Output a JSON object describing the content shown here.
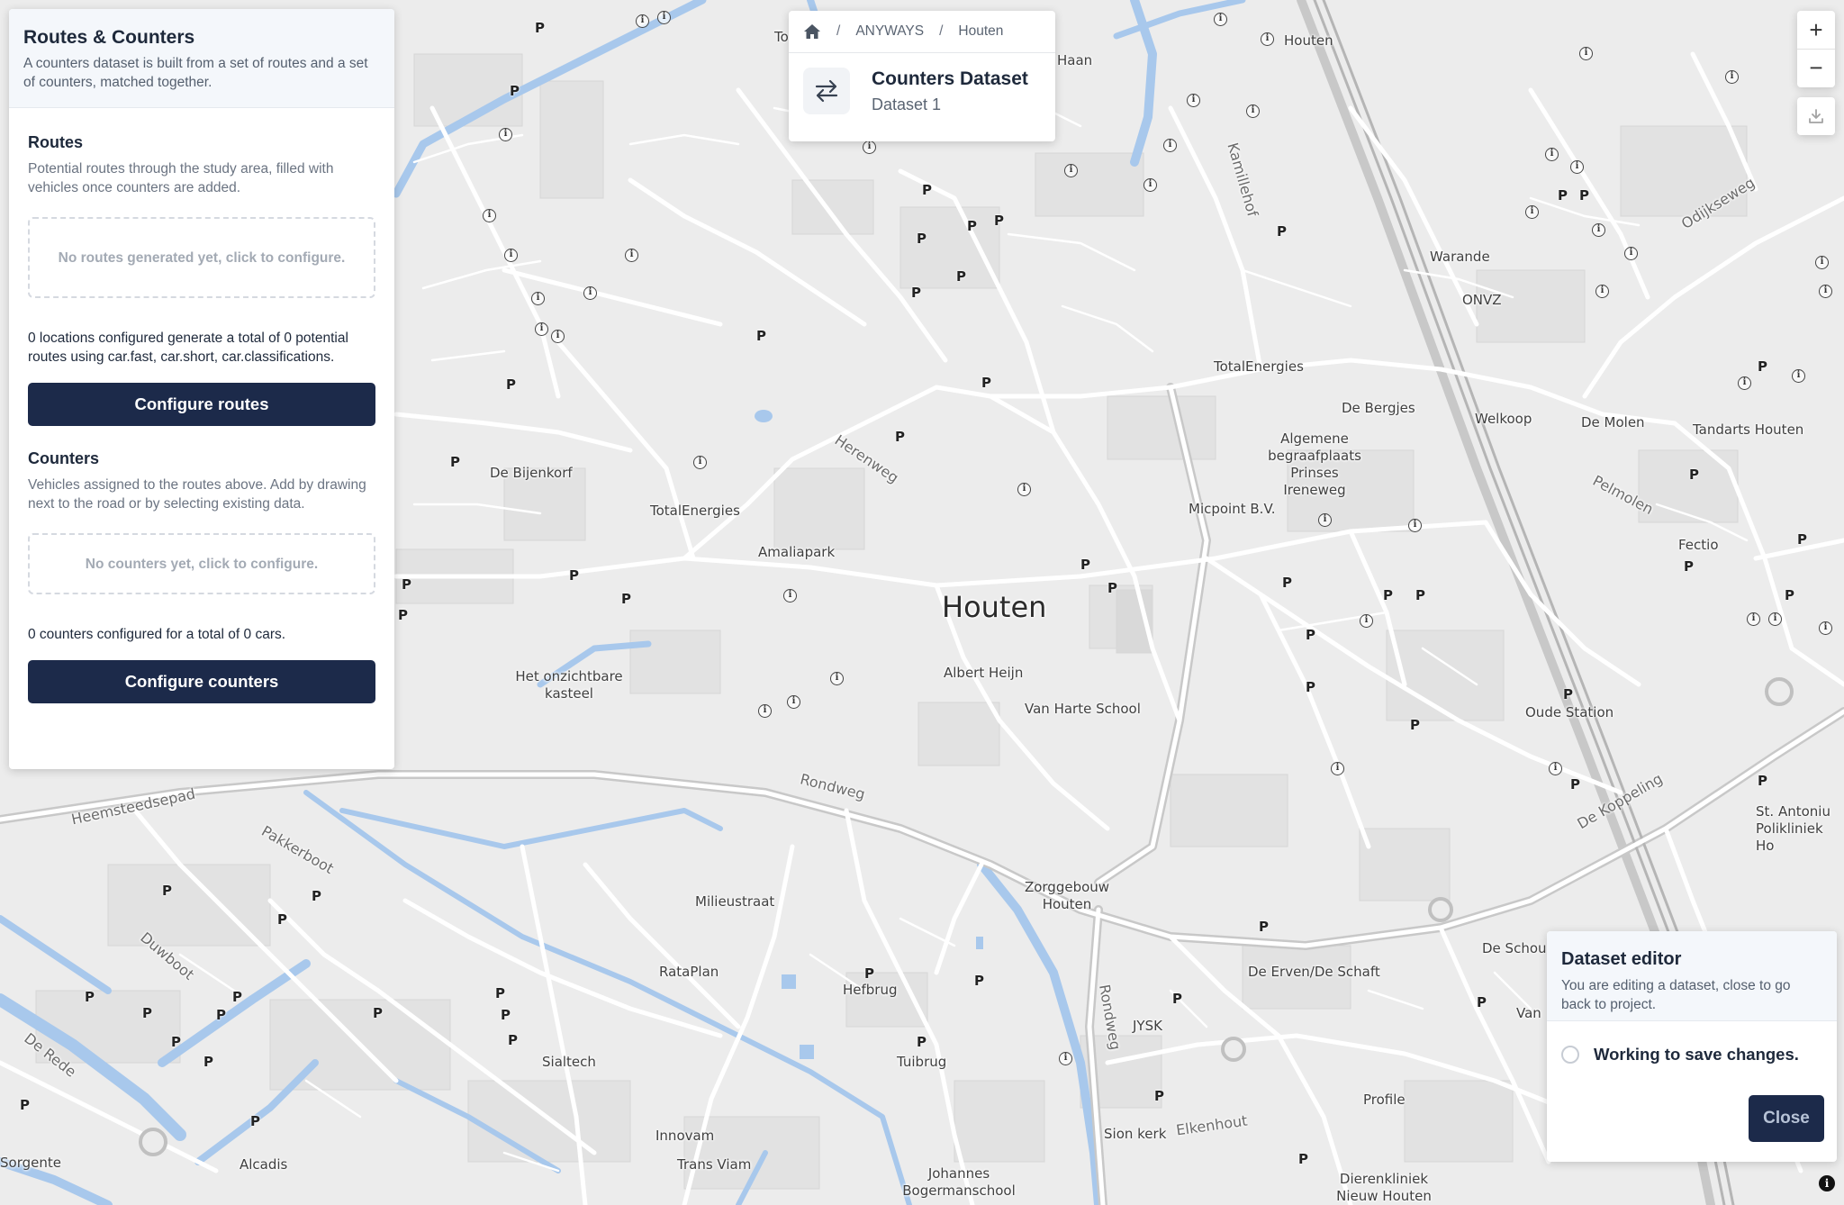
{
  "left_panel": {
    "title": "Routes & Counters",
    "description": "A counters dataset is built from a set of routes and a set of counters, matched together.",
    "routes": {
      "title": "Routes",
      "description": "Potential routes through the study area, filled with vehicles once counters are added.",
      "empty_text": "No routes generated yet, click to configure.",
      "stat": "0 locations configured generate a total of 0 potential routes using car.fast, car.short, car.classifications.",
      "button_label": "Configure routes"
    },
    "counters": {
      "title": "Counters",
      "description": "Vehicles assigned to the routes above. Add by drawing next to the road or by selecting existing data.",
      "empty_text": "No counters yet, click to configure.",
      "stat": "0 counters configured for a total of 0 cars.",
      "button_label": "Configure counters"
    }
  },
  "breadcrumb": {
    "items": [
      "ANYWAYS",
      "Houten"
    ],
    "separator": "/",
    "icons": {
      "home": "home-icon",
      "swap": "swap-arrows-icon"
    }
  },
  "dataset": {
    "title": "Counters Dataset",
    "subtitle": "Dataset 1"
  },
  "map_controls": {
    "zoom_in": "+",
    "zoom_out": "−",
    "download_icon": "download-icon"
  },
  "editor": {
    "title": "Dataset editor",
    "description": "You are editing a dataset, close to go back to project.",
    "status": "Working to save changes.",
    "close_label": "Close"
  },
  "map": {
    "city_label": "Houten",
    "places": [
      "Houten",
      "Haan",
      "To",
      "Kamillehof",
      "Warande",
      "ONVZ",
      "Odijkseweg",
      "TotalEnergies",
      "De Bergjes",
      "Welkoop",
      "De Molen",
      "Tandarts Houten",
      "Algemene begraafplaats Prinses Ireneweg",
      "De Bijenkorf",
      "TotalEnergies",
      "Herenweg",
      "Amaliapark",
      "Micpoint B.V.",
      "Pelmolen",
      "Fectio",
      "Albert Heijn",
      "Van Harte School",
      "Het onzichtbare kasteel",
      "Oude Station",
      "Rondweg",
      "Heemsteedsepad",
      "Pakkerboot",
      "Duwboot",
      "Milieustraat",
      "RataPlan",
      "Hefbrug",
      "Tuibrug",
      "Zorggebouw Houten",
      "De Koppeling",
      "St. Antoniu Polikliniek Ho",
      "De Schou",
      "De Erven/De Schaft",
      "Van",
      "JYSK",
      "Rondweg",
      "Sialtech",
      "Innovam",
      "Trans Viam",
      "Johannes Bogermanschool",
      "Sion kerk",
      "Elkenhout",
      "Profile",
      "Dierenkliniek Nieuw Houten",
      "De Rede",
      "Sorgente",
      "Alcadis"
    ],
    "attribution": "i"
  },
  "colors": {
    "primary": "#1c2a4a",
    "water": "#a8c8ec",
    "map_bg": "#ececec",
    "road": "#ffffff"
  }
}
